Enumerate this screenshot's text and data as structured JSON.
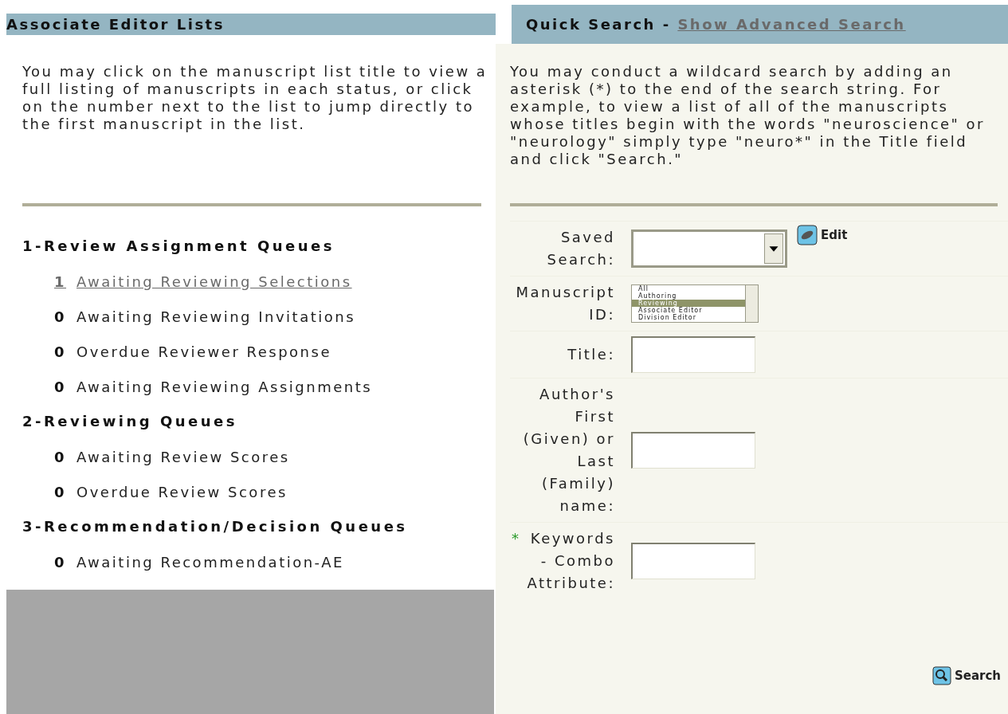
{
  "left": {
    "title": "Associate Editor Lists",
    "intro": "You may click on the manuscript list title to view a full listing of manuscripts in each status, or click on the number next to the list to jump directly to the first manuscript in the list.",
    "groups": [
      {
        "title": "1-Review Assignment Queues",
        "items": [
          {
            "count": "1",
            "label": "Awaiting Reviewing Selections",
            "link": true
          },
          {
            "count": "0",
            "label": "Awaiting Reviewing Invitations",
            "link": false
          },
          {
            "count": "0",
            "label": "Overdue Reviewer Response",
            "link": false
          },
          {
            "count": "0",
            "label": "Awaiting Reviewing Assignments",
            "link": false
          }
        ]
      },
      {
        "title": "2-Reviewing Queues",
        "items": [
          {
            "count": "0",
            "label": "Awaiting Review Scores",
            "link": false
          },
          {
            "count": "0",
            "label": "Overdue Review Scores",
            "link": false
          }
        ]
      },
      {
        "title": "3-Recommendation/Decision Queues",
        "items": [
          {
            "count": "0",
            "label": "Awaiting Recommendation-AE",
            "link": false
          }
        ]
      }
    ]
  },
  "right": {
    "title": "Quick Search - ",
    "advanced_link": "Show Advanced Search",
    "intro": "You may conduct a wildcard search by adding an asterisk (*) to the end of the search string. For example, to view a list of all of the manuscripts whose titles begin with the words \"neuroscience\" or \"neurology\" simply type \"neuro*\" in the Title field and click \"Search.\"",
    "fields": [
      {
        "kind": "dropdown",
        "label": "Saved Search:",
        "edit_button": "Edit"
      },
      {
        "kind": "listbox",
        "label": "Manuscript ID:",
        "options": [
          {
            "label": "All",
            "selected": false
          },
          {
            "label": "Authoring",
            "selected": false
          },
          {
            "label": "Reviewing",
            "selected": true
          },
          {
            "label": "Associate Editor",
            "selected": false
          },
          {
            "label": "Division Editor",
            "selected": false
          }
        ]
      },
      {
        "kind": "text",
        "label": "Title:"
      },
      {
        "kind": "text",
        "label": "Author's First (Given) or Last (Family) name:"
      },
      {
        "kind": "text",
        "label": "Keywords - Combo Attribute:",
        "marker": "*"
      }
    ],
    "search_button": "Search"
  }
}
